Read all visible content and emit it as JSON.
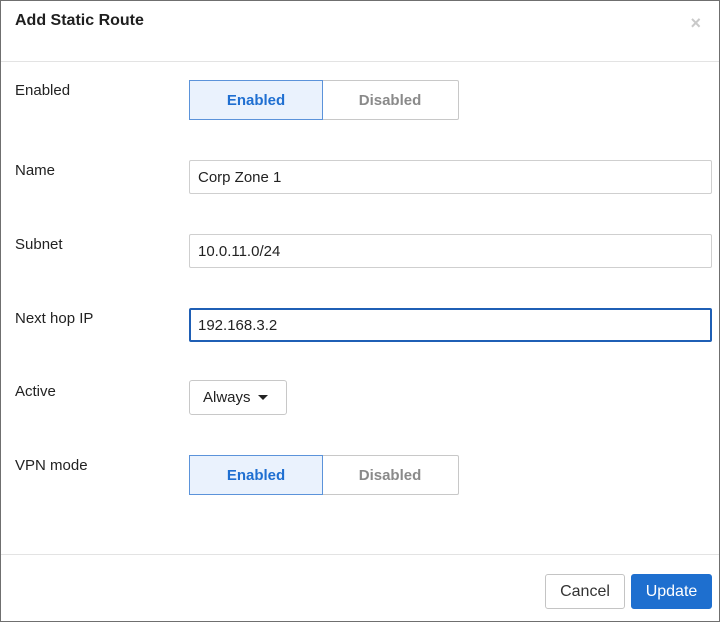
{
  "dialog": {
    "title": "Add Static Route",
    "close_icon": "×"
  },
  "fields": {
    "enabled": {
      "label": "Enabled",
      "options": [
        "Enabled",
        "Disabled"
      ],
      "selected": "Enabled"
    },
    "name": {
      "label": "Name",
      "value": "Corp Zone 1"
    },
    "subnet": {
      "label": "Subnet",
      "value": "10.0.11.0/24"
    },
    "next_hop": {
      "label": "Next hop IP",
      "value": "192.168.3.2"
    },
    "active": {
      "label": "Active",
      "selected": "Always"
    },
    "vpn_mode": {
      "label": "VPN mode",
      "options": [
        "Enabled",
        "Disabled"
      ],
      "selected": "Enabled"
    }
  },
  "footer": {
    "cancel_label": "Cancel",
    "update_label": "Update"
  },
  "colors": {
    "primary": "#1e6fcf",
    "toggle_selected_bg": "#eaf2fd",
    "toggle_selected_text": "#1f6fd1",
    "focus_border": "#1f5fb5"
  },
  "icons": {
    "close": "close-icon",
    "dropdown": "caret-down-icon"
  }
}
